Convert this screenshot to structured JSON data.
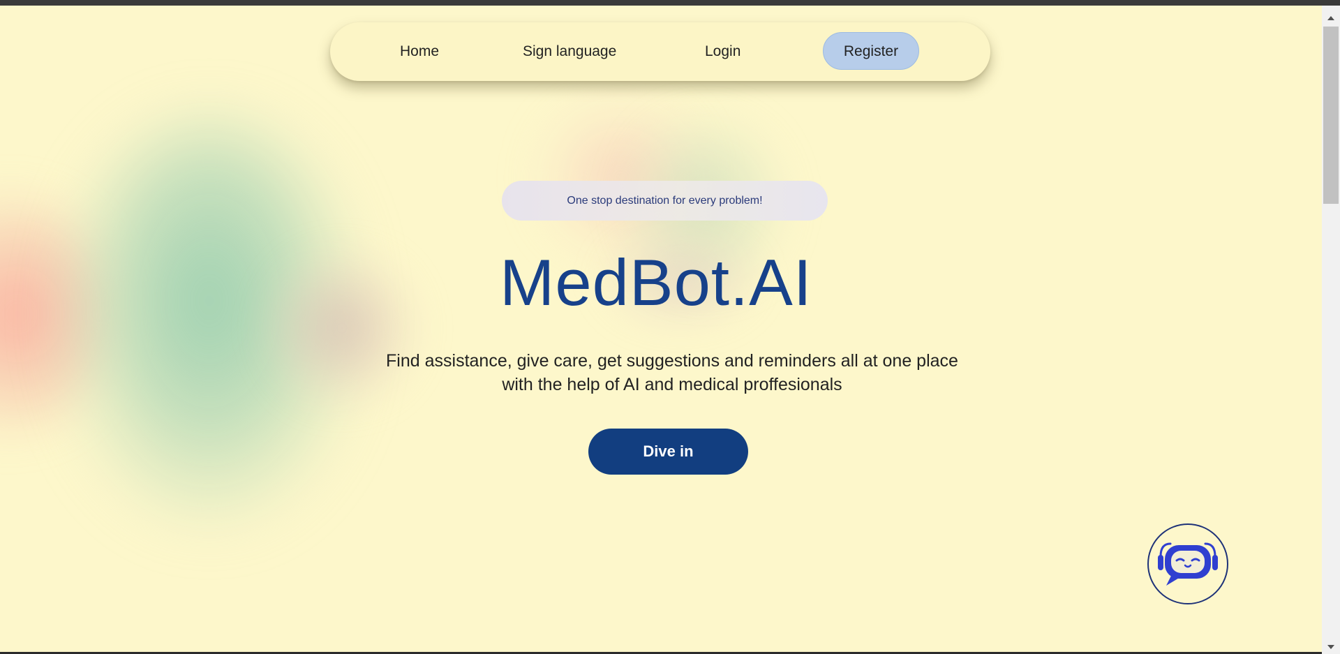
{
  "nav": {
    "home": "Home",
    "sign_language": "Sign language",
    "login": "Login",
    "register": "Register"
  },
  "hero": {
    "tagline": "One stop destination for every problem!",
    "title": "MedBot.AI",
    "subtitle_line1": "Find assistance, give care, get suggestions and reminders all at one place",
    "subtitle_line2": "with the help of AI and medical proffesionals",
    "cta": "Dive in"
  },
  "chatbot": {
    "icon": "chatbot-robot-icon"
  },
  "colors": {
    "background": "#fdf7cb",
    "primary": "#123e80",
    "title": "#17418a",
    "register_pill": "#b7cdea",
    "robot": "#2f3fd0"
  }
}
